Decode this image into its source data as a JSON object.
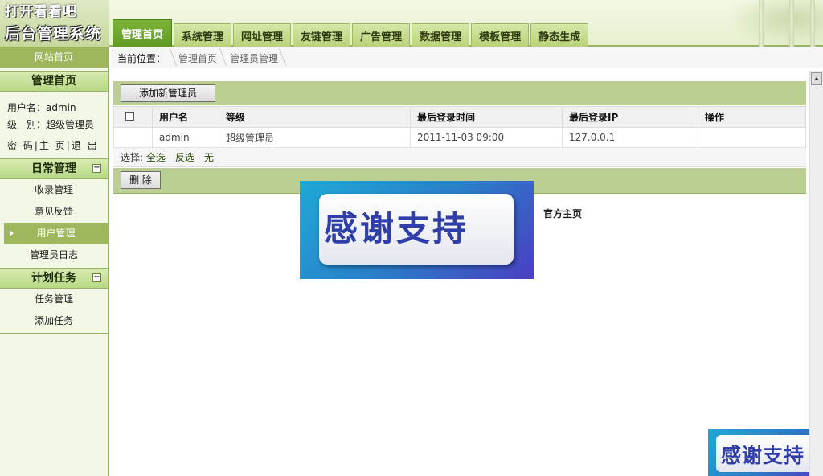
{
  "header": {
    "logo_line1": "打开看看吧",
    "logo_line2": "后台管理系统",
    "nav_tabs": [
      {
        "label": "管理首页",
        "active": true
      },
      {
        "label": "系统管理"
      },
      {
        "label": "网址管理"
      },
      {
        "label": "友链管理"
      },
      {
        "label": "广告管理"
      },
      {
        "label": "数据管理"
      },
      {
        "label": "模板管理"
      },
      {
        "label": "静态生成"
      }
    ]
  },
  "sidebar": {
    "top_link": "网站首页",
    "home_title": "管理首页",
    "user_label": "用户名：admin",
    "level_label": "级　别：超级管理员",
    "link_password": "密 码",
    "link_home": "主 页",
    "link_logout": "退 出",
    "section_daily": {
      "title": "日常管理",
      "toggle": "−",
      "items": [
        "收录管理",
        "意见反馈",
        "用户管理",
        "管理员日志"
      ],
      "active_index": 2
    },
    "section_plan": {
      "title": "计划任务",
      "toggle": "−",
      "items": [
        "任务管理",
        "添加任务"
      ]
    }
  },
  "breadcrumb": {
    "label": "当前位置：",
    "items": [
      "管理首页",
      "管理员管理"
    ]
  },
  "actions": {
    "add_admin": "添加新管理员",
    "delete": "删 除"
  },
  "table": {
    "headers": [
      "用户名",
      "等级",
      "最后登录时间",
      "最后登录IP",
      "操作"
    ],
    "rows": [
      {
        "username": "admin",
        "level": "超级管理员",
        "last_login": "2011-11-03 09:00",
        "last_ip": "127.0.0.1",
        "ops": ""
      }
    ]
  },
  "selection": {
    "label": "选择:",
    "all": "全选",
    "invert": "反选",
    "none": "无"
  },
  "footer": {
    "link": "官方主页"
  },
  "overlay": {
    "text": "感谢支持"
  },
  "colors": {
    "brand_green": "#5f9a22",
    "panel_green": "#bccf93",
    "overlay_blue": "#2a7fc9"
  }
}
